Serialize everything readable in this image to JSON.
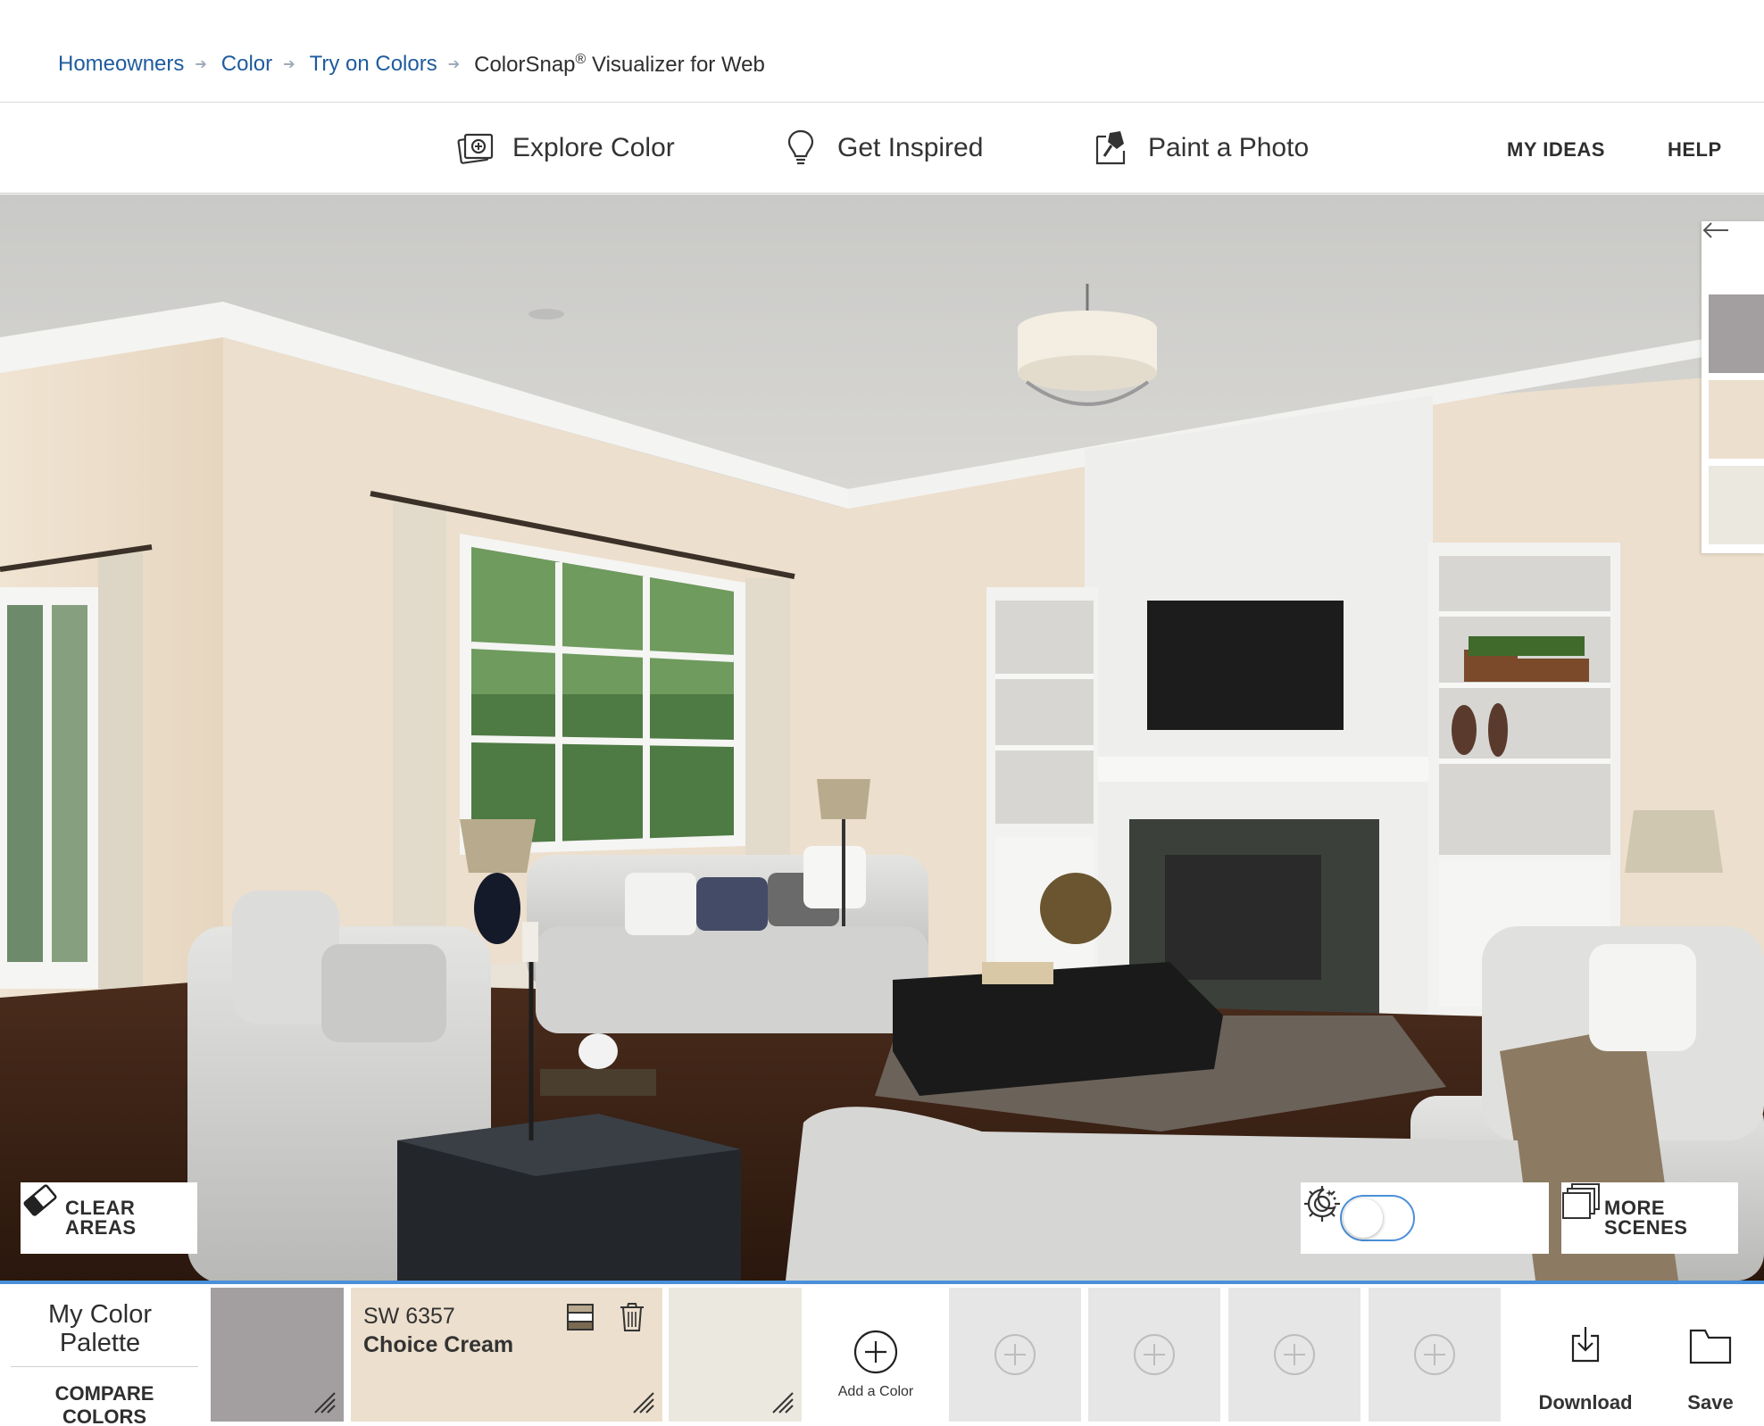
{
  "breadcrumb": {
    "items": [
      "Homeowners",
      "Color",
      "Try on Colors"
    ],
    "current": "ColorSnap",
    "current_reg": "®",
    "current_suffix": " Visualizer for Web"
  },
  "nav": {
    "explore": "Explore Color",
    "inspired": "Get Inspired",
    "paint": "Paint a Photo",
    "my_ideas": "MY IDEAS",
    "help": "HELP"
  },
  "scene_controls": {
    "clear_line1": "CLEAR",
    "clear_line2": "AREAS",
    "more_line1": "MORE",
    "more_line2": "SCENES",
    "night_mode": false
  },
  "side_palette": {
    "swatches": [
      "#a39e9f",
      "#ecdfcd",
      "#ebe8df"
    ]
  },
  "palette": {
    "title_line1": "My Color",
    "title_line2": "Palette",
    "compare": "COMPARE COLORS",
    "swatches": [
      {
        "color": "#a39e9f"
      },
      {
        "color": "#ecdfcd",
        "code": "SW 6357",
        "name": "Choice Cream"
      },
      {
        "color": "#ebe8df"
      }
    ],
    "add_label": "Add a Color",
    "empty_slots": 4,
    "download": "Download",
    "save": "Save"
  },
  "colors": {
    "link": "#1f5c9e",
    "accent": "#4a90d9",
    "wall": "#ecdfcd",
    "empty_slot": "#e6e6e6"
  },
  "icons": [
    "chevron-right-icon",
    "explore-color-icon",
    "lightbulb-icon",
    "paint-photo-icon",
    "arrow-left-icon",
    "eraser-icon",
    "sun-icon",
    "moon-icon",
    "scenes-icon",
    "layers-icon",
    "trash-icon",
    "plus-circle-icon",
    "download-icon",
    "folder-icon"
  ]
}
